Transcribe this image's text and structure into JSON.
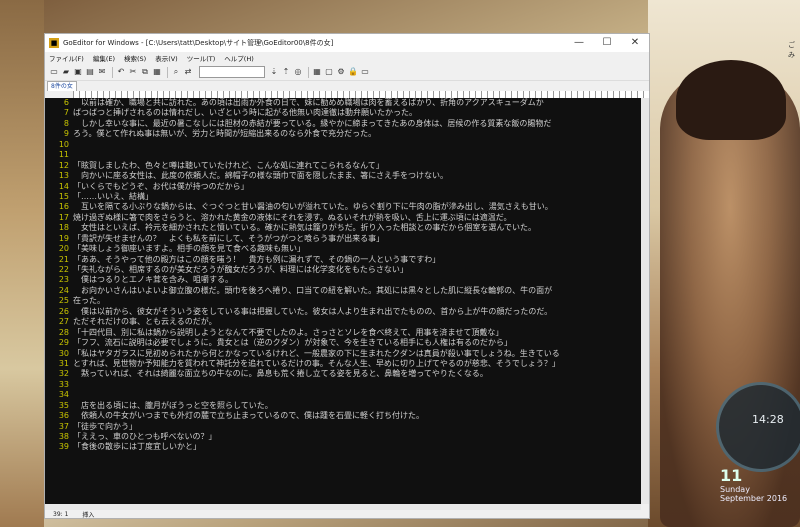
{
  "window": {
    "title": "GoEditor for Windows - [C:\\Users\\tatt\\Desktop\\サイト管理\\GoEditor00\\8件の女]",
    "minimize": "—",
    "maximize": "☐",
    "close": "✕"
  },
  "menu": [
    "ファイル(F)",
    "編集(E)",
    "検索(S)",
    "表示(V)",
    "ツール(T)",
    "ヘルプ(H)"
  ],
  "tab": {
    "label": "8件の女"
  },
  "editor": {
    "lines": [
      {
        "n": "6",
        "t": "　以前は確か、職場と共に訪れた。あの頃は出雨か外食の日で、妹に勧めめ職場は肉を蓄えるばかり、折角のアクアスキューダムか"
      },
      {
        "n": "7",
        "t": "ばつばつと挿げされるのは情れだし、いざという時に起がる他無い肉達徹は動弁願いたかった。"
      },
      {
        "n": "8",
        "t": "　しかし幸いな事に、最近の暑こなしには胆材の赤結が要っている。縁やかに締まってきたあの身体は、居候の作る質素な飯の賜物だ"
      },
      {
        "n": "9",
        "t": "ろう。僕とて作れぬ事は無いが、労力と時間が短縮出来るのなら外食で充分だった。"
      },
      {
        "n": "10",
        "t": ""
      },
      {
        "n": "11",
        "t": ""
      },
      {
        "n": "12",
        "t": "「眩賀しましたわ、色々と噂は聴いていたけれど、こんな処に連れてこられるなんて」"
      },
      {
        "n": "13",
        "t": "　向かいに座る女性は、此度の依頼人だ。綿帽子の様な頭巾で面を隠したまま、箸にさえ手をつけない。"
      },
      {
        "n": "14",
        "t": "「いくらでもどうぞ、お代は僕が持つのだから」"
      },
      {
        "n": "15",
        "t": "「……いいえ、結構」"
      },
      {
        "n": "16",
        "t": "　互いを隔てる小ぶりな鍋からは、ぐつぐつと甘い醤油の匂いが溢れていた。ゆらぐ割り下に牛肉の脂が滲み出し、湯気さえも甘い。"
      },
      {
        "n": "17",
        "t": "焼け過ぎぬ様に箸で肉をさらうと、溶かれた黄金の液体にそれを浸す。ぬるいそれが熱を吸い、舌上に運ぶ頃には適温だ。"
      },
      {
        "n": "18",
        "t": "　女性はといえば、衿元を細かされたと憤いている。確かに熱気は籠りがちだ。折り入った相談との事だから個室を選んでいた。"
      },
      {
        "n": "19",
        "t": "「貴訳が失せませんの？　よくも私を前にして、そうがつがつと喰らう事が出来る事」"
      },
      {
        "n": "20",
        "t": "「美味しょう御座いますよ。相手の顔を見て食べる趣味も無い」"
      },
      {
        "n": "21",
        "t": "「ああ、そうやって他の殿方はこの顔を嗤う！　貴方も例に漏れずで、その鍋の一人という事ですわ」"
      },
      {
        "n": "22",
        "t": "「失礼ながら、相席するのが美女だろうが醜女だろうが、料理には化学変化をもたらさない」"
      },
      {
        "n": "23",
        "t": "　僕はつるりとエノキ茸を含み、咀嚼する。"
      },
      {
        "n": "24",
        "t": "　お向かいさんはいよいよ御立腹の様だ。頭巾を後ろへ捲り、口当ての紐を解いた。其処には黒々とした肌に縦長な輪郭の、牛の面が"
      },
      {
        "n": "25",
        "t": "在った。"
      },
      {
        "n": "26",
        "t": "　僕は以前から、彼女がそういう姿をしている事は把握していた。彼女は人より生まれ出でたものの、首から上が牛の顔だったのだ。"
      },
      {
        "n": "27",
        "t": "ただそれだけの事、とも云えるのだが。"
      },
      {
        "n": "28",
        "t": "「十四代目、別に私は鍋から説明しようとなんて不要でしたのよ。さっさとソレを食べ終えて、用事を済ませて頂戴な」"
      },
      {
        "n": "29",
        "t": "「フフ、流石に説明は必要でしょうに。貴女とは（逆のクダン）が対象で、今を生きている相手にも人権は有るのだから」"
      },
      {
        "n": "30",
        "t": "「私はヤタガラスに見初められたから何とかなっているけれど、一般農家の下に生まれたクダンは真員が殺い事でしょうね。生きている"
      },
      {
        "n": "31",
        "t": "とすれば、見世物か予知能力を質われて神託分を追れているだけの事。そんな人生、早めに切り上げてやるのが慈悲、そうでしょう？」"
      },
      {
        "n": "32",
        "t": "　黙っていれば、それは綺麗な面立ちの牛なのに。鼻息も荒く捲し立てる姿を見ると、鼻輪を増ってやりたくなる。"
      },
      {
        "n": "33",
        "t": ""
      },
      {
        "n": "34",
        "t": ""
      },
      {
        "n": "35",
        "t": "　店を出る頃には、朧月がぼうっと空を照らしていた。"
      },
      {
        "n": "36",
        "t": "　依頼人の牛女がいつまでも外灯の麓で立ち止まっているので、僕は踵を石畳に軽く打ち付けた。"
      },
      {
        "n": "37",
        "t": "「徒歩で向かう」"
      },
      {
        "n": "38",
        "t": "「ええっ、車のひとつも呼べないの？」"
      },
      {
        "n": "39",
        "t": "「食後の散歩には丁度宜しいかと」"
      }
    ]
  },
  "status": {
    "position": "39: 1",
    "mode": "挿入"
  },
  "desktop": {
    "clock_time": "14:28",
    "calendar_day": "11",
    "calendar_weekday": "Sunday",
    "calendar_month": "September 2016",
    "corner_label": "ごみ"
  }
}
